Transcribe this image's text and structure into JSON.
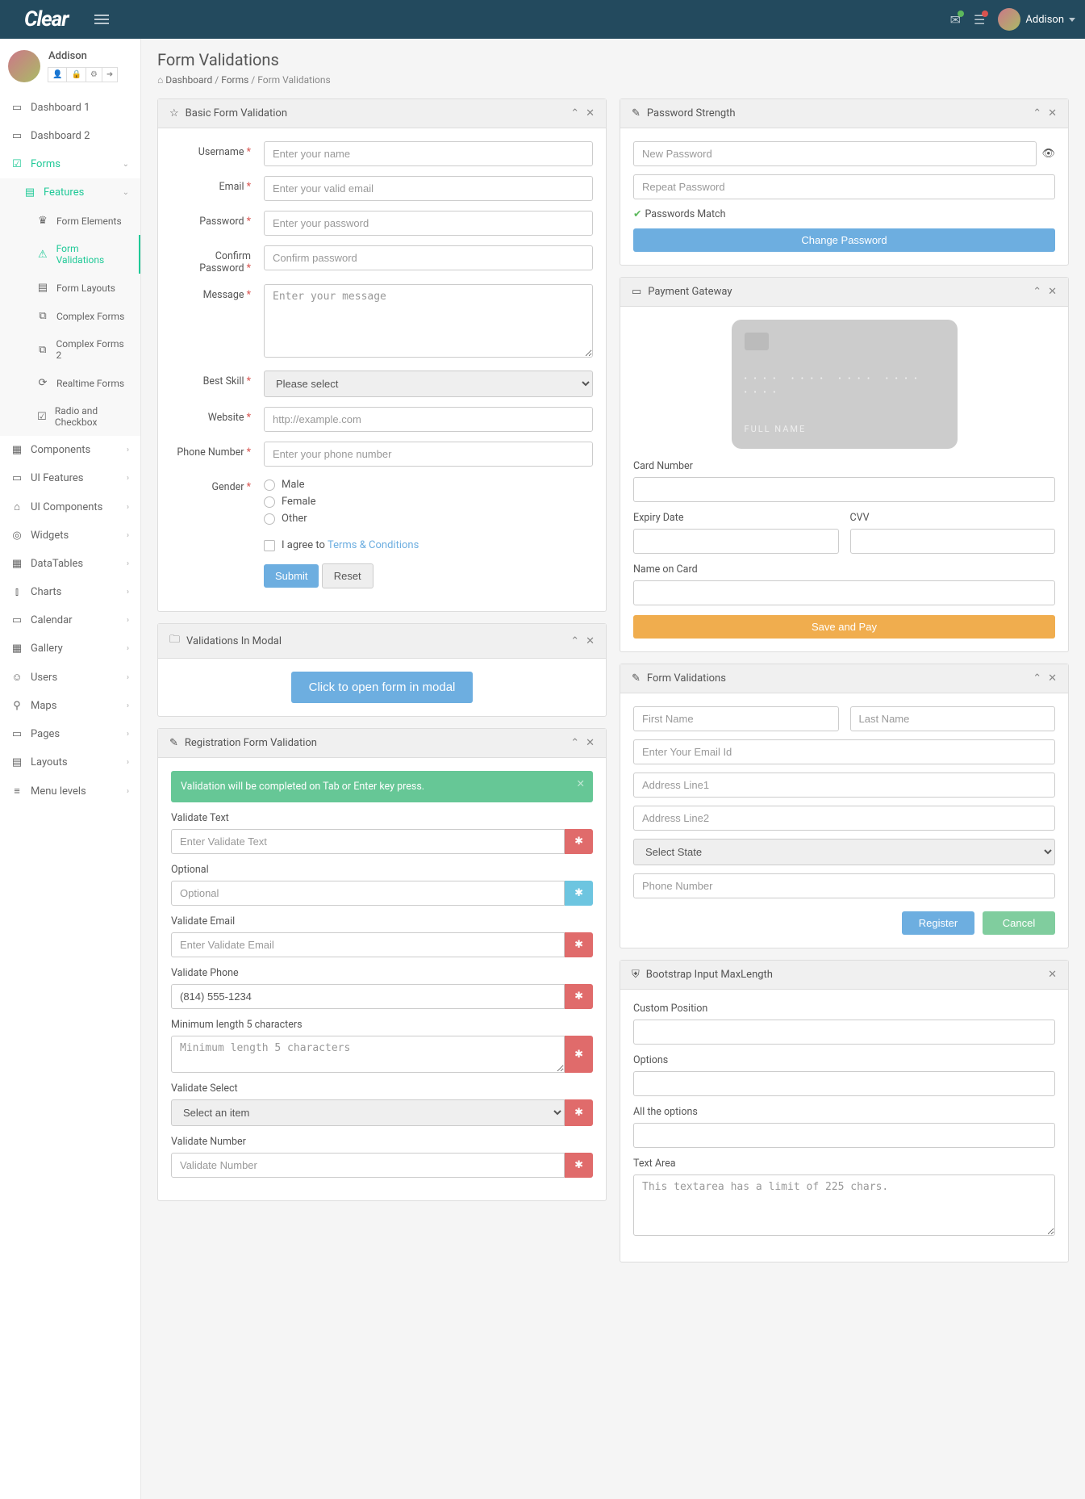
{
  "brand": "Clear",
  "user": {
    "name": "Addison"
  },
  "page": {
    "title": "Form Validations",
    "breadcrumb": [
      "Dashboard",
      "Forms",
      "Form Validations"
    ]
  },
  "sidebar": {
    "items": [
      {
        "icon": "▭",
        "label": "Dashboard 1"
      },
      {
        "icon": "▭",
        "label": "Dashboard 2"
      },
      {
        "icon": "☑",
        "label": "Forms",
        "teal": true,
        "expand": "down"
      },
      {
        "icon": "▤",
        "label": "Features",
        "sub": true,
        "teal": true,
        "expand": "down"
      },
      {
        "icon": "♛",
        "label": "Form Elements",
        "sub2": true
      },
      {
        "icon": "⚠",
        "label": "Form Validations",
        "sub2": true,
        "active": true
      },
      {
        "icon": "▤",
        "label": "Form Layouts",
        "sub2": true
      },
      {
        "icon": "⧉",
        "label": "Complex Forms",
        "sub2": true
      },
      {
        "icon": "⧉",
        "label": "Complex Forms 2",
        "sub2": true
      },
      {
        "icon": "⟳",
        "label": "Realtime Forms",
        "sub2": true
      },
      {
        "icon": "☑",
        "label": "Radio and Checkbox",
        "sub2": true
      },
      {
        "icon": "▦",
        "label": "Components",
        "expand": "right"
      },
      {
        "icon": "▭",
        "label": "UI Features",
        "expand": "right"
      },
      {
        "icon": "⌂",
        "label": "UI Components",
        "expand": "right"
      },
      {
        "icon": "◎",
        "label": "Widgets",
        "expand": "right"
      },
      {
        "icon": "▦",
        "label": "DataTables",
        "expand": "right"
      },
      {
        "icon": "⫾",
        "label": "Charts",
        "expand": "right"
      },
      {
        "icon": "▭",
        "label": "Calendar",
        "expand": "right"
      },
      {
        "icon": "▦",
        "label": "Gallery",
        "expand": "right"
      },
      {
        "icon": "☺",
        "label": "Users",
        "expand": "right"
      },
      {
        "icon": "⚲",
        "label": "Maps",
        "expand": "right"
      },
      {
        "icon": "▭",
        "label": "Pages",
        "expand": "right"
      },
      {
        "icon": "▤",
        "label": "Layouts",
        "expand": "right"
      },
      {
        "icon": "≡",
        "label": "Menu levels",
        "expand": "right"
      }
    ]
  },
  "panels": {
    "basic": {
      "title": "Basic Form Validation",
      "fields": {
        "username": {
          "label": "Username",
          "ph": "Enter your name"
        },
        "email": {
          "label": "Email",
          "ph": "Enter your valid email"
        },
        "password": {
          "label": "Password",
          "ph": "Enter your password"
        },
        "confirm": {
          "label": "Confirm Password",
          "ph": "Confirm password"
        },
        "message": {
          "label": "Message",
          "ph": "Enter your message"
        },
        "skill": {
          "label": "Best Skill",
          "ph": "Please select"
        },
        "website": {
          "label": "Website",
          "ph": "http://example.com"
        },
        "phone": {
          "label": "Phone Number",
          "ph": "Enter your phone number"
        },
        "gender": {
          "label": "Gender",
          "opts": [
            "Male",
            "Female",
            "Other"
          ]
        },
        "terms_pre": "I agree to ",
        "terms_link": "Terms & Conditions"
      },
      "submit": "Submit",
      "reset": "Reset"
    },
    "modal": {
      "title": "Validations In Modal",
      "btn": "Click to open form in modal"
    },
    "reg": {
      "title": "Registration Form Validation",
      "alert": "Validation will be completed on Tab or Enter key press.",
      "fields": {
        "text": {
          "label": "Validate Text",
          "ph": "Enter Validate Text"
        },
        "optional": {
          "label": "Optional",
          "ph": "Optional"
        },
        "email": {
          "label": "Validate Email",
          "ph": "Enter Validate Email"
        },
        "phone": {
          "label": "Validate Phone",
          "val": "(814) 555-1234"
        },
        "minlen": {
          "label": "Minimum length 5 characters",
          "ph": "Minimum length 5 characters"
        },
        "select": {
          "label": "Validate Select",
          "ph": "Select an item"
        },
        "number": {
          "label": "Validate Number",
          "ph": "Validate Number"
        }
      }
    },
    "pw": {
      "title": "Password Strength",
      "new_ph": "New Password",
      "repeat_ph": "Repeat Password",
      "match": "Passwords Match",
      "btn": "Change Password"
    },
    "pay": {
      "title": "Payment Gateway",
      "card_name_ph": "FULL  NAME",
      "num": "Card Number",
      "exp": "Expiry Date",
      "cvv": "CVV",
      "name": "Name on Card",
      "btn": "Save and Pay"
    },
    "fv": {
      "title": "Form Validations",
      "first": "First Name",
      "last": "Last Name",
      "email": "Enter Your Email Id",
      "addr1": "Address Line1",
      "addr2": "Address Line2",
      "state": "Select State",
      "phone": "Phone Number",
      "register": "Register",
      "cancel": "Cancel"
    },
    "maxlen": {
      "title": "Bootstrap Input MaxLength",
      "custom": "Custom Position",
      "options": "Options",
      "all": "All the options",
      "ta": "Text Area",
      "ta_ph": "This textarea has a limit of 225 chars."
    }
  }
}
